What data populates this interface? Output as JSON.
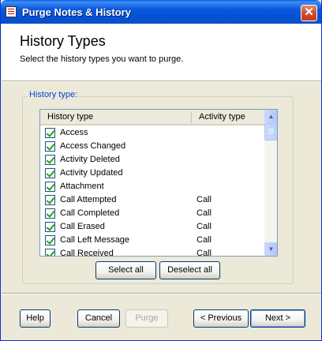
{
  "window": {
    "title": "Purge Notes & History",
    "close_glyph": "✕"
  },
  "header": {
    "title": "History Types",
    "subtitle": "Select the history types you want to purge."
  },
  "group": {
    "label": "History type:"
  },
  "list": {
    "columns": {
      "type": "History type",
      "activity": "Activity type"
    },
    "rows": [
      {
        "name": "Access",
        "activity": "",
        "checked": true
      },
      {
        "name": "Access Changed",
        "activity": "",
        "checked": true
      },
      {
        "name": "Activity Deleted",
        "activity": "",
        "checked": true
      },
      {
        "name": "Activity Updated",
        "activity": "",
        "checked": true
      },
      {
        "name": "Attachment",
        "activity": "",
        "checked": true
      },
      {
        "name": "Call Attempted",
        "activity": "Call",
        "checked": true
      },
      {
        "name": "Call Completed",
        "activity": "Call",
        "checked": true
      },
      {
        "name": "Call Erased",
        "activity": "Call",
        "checked": true
      },
      {
        "name": "Call Left Message",
        "activity": "Call",
        "checked": true
      },
      {
        "name": "Call Received",
        "activity": "Call",
        "checked": true
      }
    ],
    "scroll_up_glyph": "▲",
    "scroll_down_glyph": "▼"
  },
  "buttons": {
    "select_all": "Select all",
    "deselect_all": "Deselect all",
    "help": "Help",
    "cancel": "Cancel",
    "purge": "Purge",
    "previous": "< Previous",
    "next": "Next >"
  },
  "colors": {
    "titlebar": "#0a58dc",
    "group_label": "#0046d5",
    "checkmark": "#21a121"
  }
}
